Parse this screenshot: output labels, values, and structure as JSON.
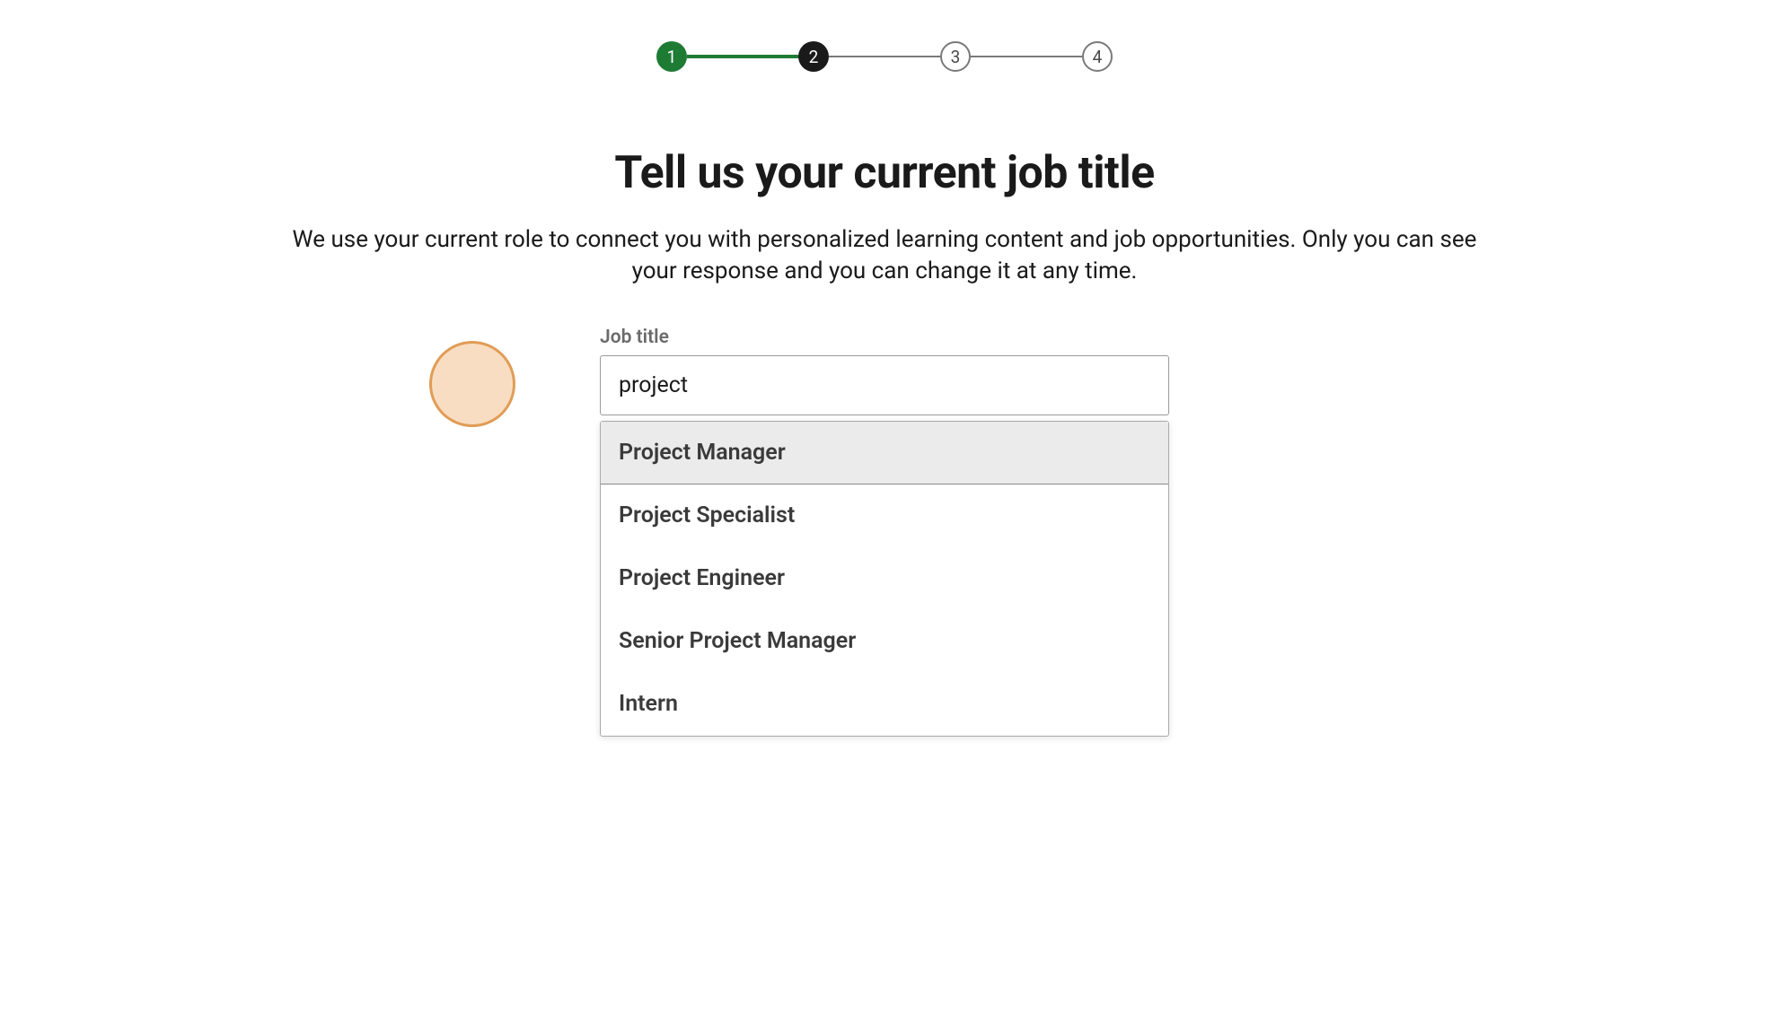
{
  "progress": {
    "steps": [
      "1",
      "2",
      "3",
      "4"
    ],
    "current_index": 1
  },
  "title": "Tell us your current job title",
  "subtitle": "We use your current role to connect you with personalized learning content and job opportunities. Only you can see your response and you can change it at any time.",
  "form": {
    "label": "Job title",
    "value": "project"
  },
  "suggestions": {
    "items": [
      "Project Manager",
      "Project Specialist",
      "Project Engineer",
      "Senior Project Manager",
      "Intern"
    ],
    "highlighted_index": 0
  }
}
